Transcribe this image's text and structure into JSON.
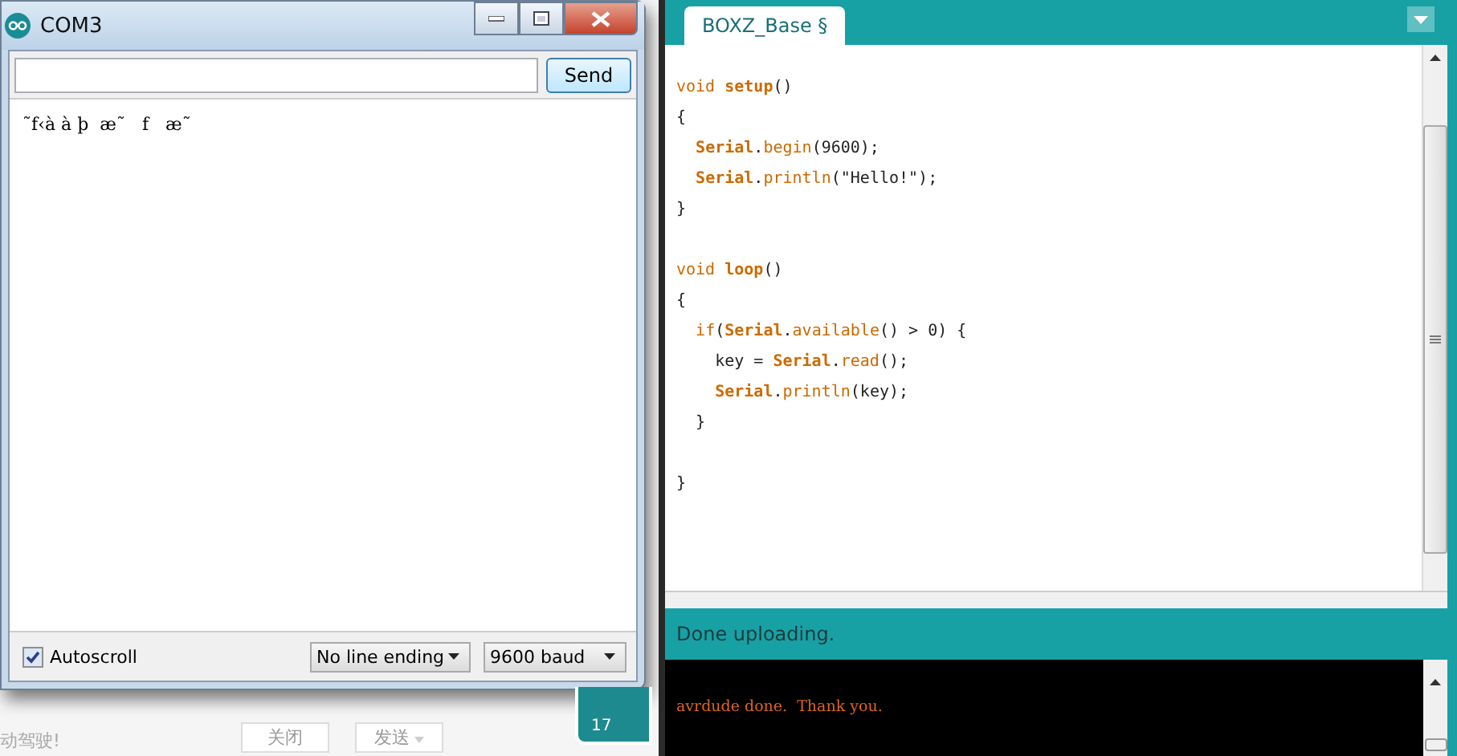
{
  "serial_monitor": {
    "title": "COM3",
    "send_button": "Send",
    "output": "˜f‹à à þ  æ˜   f   æ˜",
    "autoscroll": {
      "label": "Autoscroll",
      "checked": true
    },
    "line_ending": "No line ending",
    "baud": "9600 baud"
  },
  "background_page": {
    "text": "动驾驶!",
    "buttons": [
      "关闭",
      "发送"
    ],
    "badge": "17"
  },
  "editor": {
    "tabs": [
      {
        "label": "BOXZ_Base §",
        "selected": true
      }
    ],
    "blocks": [
      [
        "*void* **setup**()",
        "{",
        "  **Serial**.*begin*(9600);",
        "  **Serial**.*println*(\"Hello!\");",
        "}"
      ],
      [
        "*void* **loop**()",
        "{",
        "  *if*(**Serial**.*available*() > 0) {",
        "    key = **Serial**.*read*();",
        "    **Serial**.*println*(key);",
        "  }"
      ],
      [
        "}"
      ]
    ],
    "status": "Done uploading.",
    "console": "avrdude done.  Thank you."
  }
}
